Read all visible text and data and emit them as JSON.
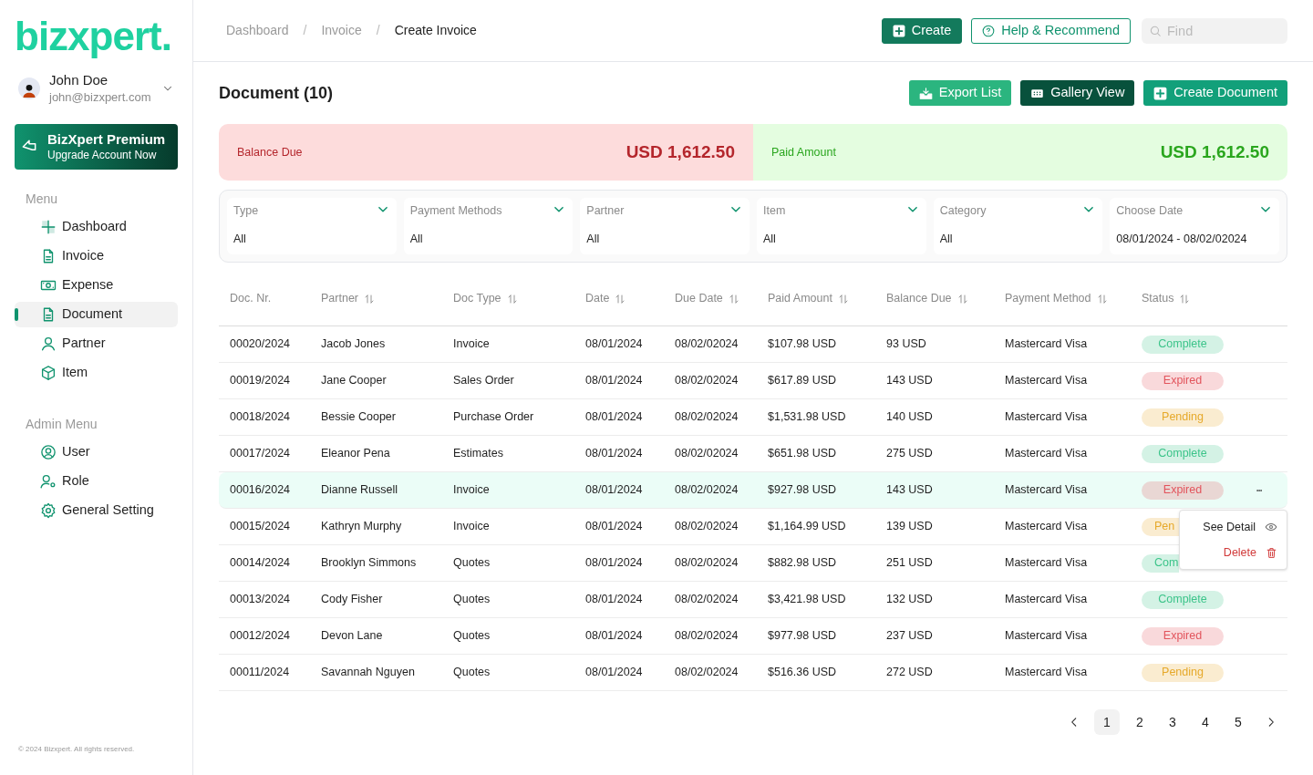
{
  "sidebar": {
    "logo": "bizxpert.",
    "user": {
      "name": "John Doe",
      "email": "john@bizxpert.com"
    },
    "promo": {
      "title": "BizXpert Premium",
      "subtitle": "Upgrade Account Now"
    },
    "sections": [
      {
        "title": "Menu",
        "items": [
          {
            "label": "Dashboard",
            "selected": false
          },
          {
            "label": "Invoice",
            "selected": false
          },
          {
            "label": "Expense",
            "selected": false
          },
          {
            "label": "Document",
            "selected": true
          },
          {
            "label": "Partner",
            "selected": false
          },
          {
            "label": "Item",
            "selected": false
          }
        ]
      },
      {
        "title": "Admin Menu",
        "items": [
          {
            "label": "User",
            "selected": false
          },
          {
            "label": "Role",
            "selected": false
          },
          {
            "label": "General Setting",
            "selected": false
          }
        ]
      }
    ],
    "footer": "© 2024 Bizxpert. All rights reserved."
  },
  "breadcrumb": {
    "separator": "/",
    "items": [
      "Dashboard",
      "Invoice",
      "Create Invoice"
    ]
  },
  "header_buttons": [
    {
      "label": "Create",
      "kind": "solid"
    },
    {
      "label": "Help & Recommend",
      "kind": "outline"
    }
  ],
  "search": {
    "placeholder": "Find"
  },
  "page_title": "Document (10)",
  "actions": [
    {
      "label": "Export List",
      "kind": "export"
    },
    {
      "label": "Gallery View",
      "kind": "gallery"
    },
    {
      "label": "Create Document",
      "kind": "create"
    }
  ],
  "summary": [
    {
      "label": "Balance Due",
      "value": "USD 1,612.50",
      "kind": "due"
    },
    {
      "label": "Paid Amount",
      "value": "USD 1,612.50",
      "kind": "paid"
    }
  ],
  "filters": [
    {
      "label": "Type",
      "value": "All"
    },
    {
      "label": "Payment Methods",
      "value": "All"
    },
    {
      "label": "Partner",
      "value": "All"
    },
    {
      "label": "Item",
      "value": "All"
    },
    {
      "label": "Category",
      "value": "All"
    },
    {
      "label": "Choose Date",
      "value": "08/01/2024 - 08/02/02024"
    }
  ],
  "table": {
    "columns": [
      {
        "label": "Doc. Nr.",
        "sortable": false
      },
      {
        "label": "Partner",
        "sortable": true
      },
      {
        "label": "Doc Type",
        "sortable": true
      },
      {
        "label": "Date",
        "sortable": true
      },
      {
        "label": "Due Date",
        "sortable": true
      },
      {
        "label": "Paid Amount",
        "sortable": true
      },
      {
        "label": "Balance Due",
        "sortable": true
      },
      {
        "label": "Payment Method",
        "sortable": true
      },
      {
        "label": "Status",
        "sortable": true
      }
    ],
    "rows": [
      {
        "cells": [
          "00020/2024",
          "Jacob Jones",
          "Invoice",
          "08/01/2024",
          "08/02/02024",
          "$107.98 USD",
          "93 USD",
          "Mastercard Visa"
        ],
        "status": "Complete",
        "color": "#3cc48a",
        "partly_hidden": false,
        "selected": false
      },
      {
        "cells": [
          "00019/2024",
          "Jane Cooper",
          "Sales Order",
          "08/01/2024",
          "08/02/02024",
          "$617.89 USD",
          "143 USD",
          "Mastercard Visa"
        ],
        "status": "Expired",
        "color": "#e2545c",
        "partly_hidden": false,
        "selected": false
      },
      {
        "cells": [
          "00018/2024",
          "Bessie Cooper",
          "Purchase Order",
          "08/01/2024",
          "08/02/02024",
          "$1,531.98 USD",
          "140 USD",
          "Mastercard Visa"
        ],
        "status": "Pending",
        "color": "#e6a92b",
        "partly_hidden": false,
        "selected": false
      },
      {
        "cells": [
          "00017/2024",
          "Eleanor Pena",
          "Estimates",
          "08/01/2024",
          "08/02/02024",
          "$651.98 USD",
          "275 USD",
          "Mastercard Visa"
        ],
        "status": "Complete",
        "color": "#3cc48a",
        "partly_hidden": false,
        "selected": false
      },
      {
        "cells": [
          "00016/2024",
          "Dianne Russell",
          "Invoice",
          "08/01/2024",
          "08/02/02024",
          "$927.98 USD",
          "143 USD",
          "Mastercard Visa"
        ],
        "status": "Expired",
        "color": "#e2545c",
        "partly_hidden": false,
        "selected": true
      },
      {
        "cells": [
          "00015/2024",
          "Kathryn Murphy",
          "Invoice",
          "08/01/2024",
          "08/02/02024",
          "$1,164.99 USD",
          "139 USD",
          "Mastercard Visa"
        ],
        "status": "Pen",
        "color": "#e6a92b",
        "partly_hidden": true,
        "selected": false
      },
      {
        "cells": [
          "00014/2024",
          "Brooklyn Simmons",
          "Quotes",
          "08/01/2024",
          "08/02/02024",
          "$882.98 USD",
          "251 USD",
          "Mastercard Visa"
        ],
        "status": "Com",
        "color": "#3cc48a",
        "partly_hidden": true,
        "selected": false
      },
      {
        "cells": [
          "00013/2024",
          "Cody Fisher",
          "Quotes",
          "08/01/2024",
          "08/02/02024",
          "$3,421.98 USD",
          "132 USD",
          "Mastercard Visa"
        ],
        "status": "Complete",
        "color": "#3cc48a",
        "partly_hidden": false,
        "selected": false
      },
      {
        "cells": [
          "00012/2024",
          "Devon Lane",
          "Quotes",
          "08/01/2024",
          "08/02/02024",
          "$977.98 USD",
          "237 USD",
          "Mastercard Visa"
        ],
        "status": "Expired",
        "color": "#e2545c",
        "partly_hidden": false,
        "selected": false
      },
      {
        "cells": [
          "00011/2024",
          "Savannah Nguyen",
          "Quotes",
          "08/01/2024",
          "08/02/02024",
          "$516.36 USD",
          "272 USD",
          "Mastercard Visa"
        ],
        "status": "Pending",
        "color": "#e6a92b",
        "partly_hidden": false,
        "selected": false
      }
    ]
  },
  "row_menu": {
    "items": [
      {
        "label": "See Detail",
        "kind": "view"
      },
      {
        "label": "Delete",
        "kind": "delete"
      }
    ]
  },
  "pagination": {
    "pages": [
      {
        "label": "1",
        "selected": true
      },
      {
        "label": "2",
        "selected": false
      },
      {
        "label": "3",
        "selected": false
      },
      {
        "label": "4",
        "selected": false
      },
      {
        "label": "5",
        "selected": false
      }
    ]
  }
}
